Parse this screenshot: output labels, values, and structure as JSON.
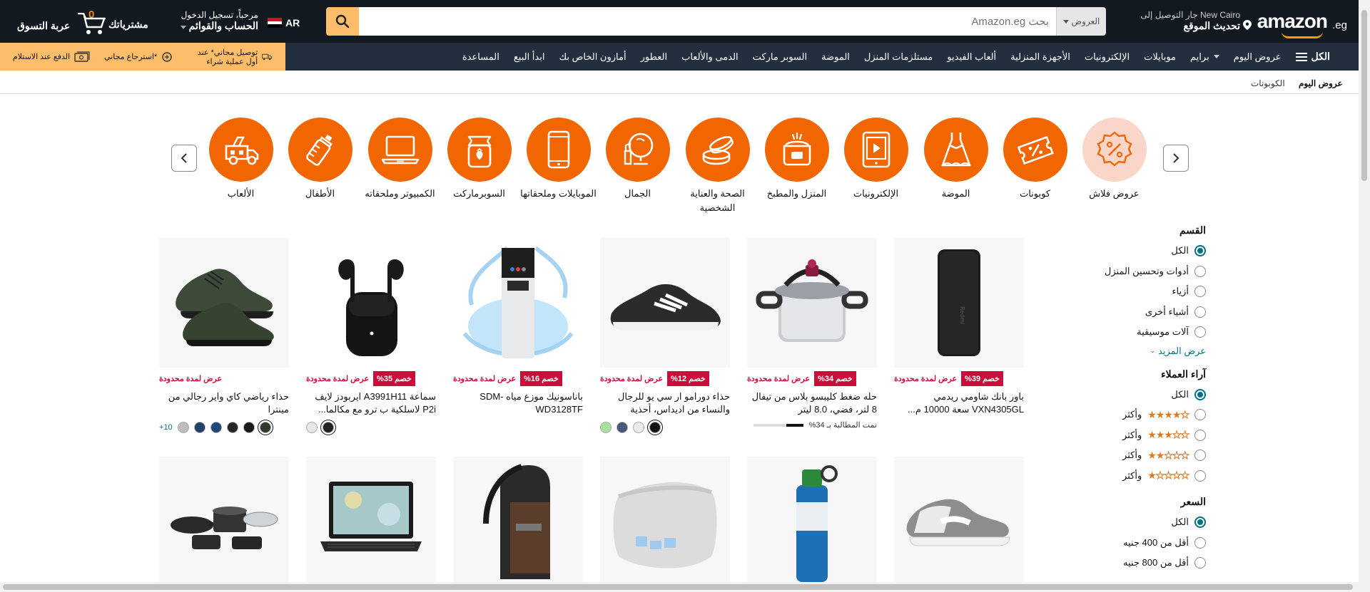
{
  "header": {
    "logo_text": "amazon",
    "logo_tld": ".eg",
    "deliver_line1": "جار التوصيل إلى New Cairo",
    "deliver_line2": "تحديث الموقع",
    "search_dept": "العروض",
    "search_placeholder": "بحث Amazon.eg",
    "lang": "AR",
    "account_line1": "مرحباً، تسجيل الدخول",
    "account_line2": "الحساب والقوائم",
    "orders": "مشترياتك",
    "cart_label": "عربة التسوق",
    "cart_count": "0"
  },
  "nav": {
    "all": "الكل",
    "items": [
      "عروض اليوم",
      "برايم",
      "موبايلات",
      "الإلكترونيات",
      "الأجهزة المنزلية",
      "ألعاب الفيديو",
      "مستلزمات المنزل",
      "الموضة",
      "السوبر ماركت",
      "الدمى والألعاب",
      "العطور",
      "أمازون الخاص بك",
      "ابدأ البيع",
      "المساعدة"
    ],
    "promo": [
      "توصيل مجاني* عند أول عملية شراء",
      "استرجاع مجاني*",
      "الدفع عند الاستلام"
    ]
  },
  "breadcrumb": [
    "عروض اليوم",
    "الكوبونات"
  ],
  "categories": [
    {
      "label": "عروض فلاش",
      "icon": "percent-badge-icon"
    },
    {
      "label": "كوبونات",
      "icon": "coupon-icon"
    },
    {
      "label": "الموضة",
      "icon": "dress-icon"
    },
    {
      "label": "الإلكترونيات",
      "icon": "tablet-play-icon"
    },
    {
      "label": "المنزل والمطبخ",
      "icon": "rice-cooker-icon"
    },
    {
      "label": "الصحة والعناية الشخصية",
      "icon": "cream-jar-icon"
    },
    {
      "label": "الجمال",
      "icon": "mirror-lipstick-icon"
    },
    {
      "label": "الموبايلات وملحقاتها",
      "icon": "phone-icon"
    },
    {
      "label": "السوبرماركت",
      "icon": "jam-jar-icon"
    },
    {
      "label": "الكمبيوتر وملحقاته",
      "icon": "laptop-icon"
    },
    {
      "label": "الأطفال",
      "icon": "baby-bottle-icon"
    },
    {
      "label": "الألعاب",
      "icon": "toy-truck-icon"
    }
  ],
  "sidebar": {
    "dept_title": "القسم",
    "dept_options": [
      "الكل",
      "أدوات وتحسين المنزل",
      "أزياء",
      "أشياء أخرى",
      "آلات موسيقية"
    ],
    "see_more": "عرض المزيد",
    "reviews_title": "آراء العملاء",
    "reviews_all": "الكل",
    "reviews_and_up": "وأكثر",
    "reviews_stars": [
      4,
      3,
      2,
      1
    ],
    "price_title": "السعر",
    "price_options": [
      "الكل",
      "أقل من 400 جنيه",
      "أقل من 800 جنيه"
    ]
  },
  "products": [
    {
      "title": "باور بانك شاومي ريدمي VXN4305GL سعة 10000 م...",
      "discount": "خصم 39%",
      "deal": "عرض لمدة محدودة",
      "image": "power-bank"
    },
    {
      "title": "حله ضغط كليبسو بلاس من تيفال 8 لتر، فضي، 8.0 ليتر",
      "discount": "خصم 34%",
      "deal": "عرض لمدة محدودة",
      "image": "pressure-cooker",
      "claimed": "تمت المطالبة بـ 34%",
      "claimed_pct": 34
    },
    {
      "title": "حذاء دورامو ار سي يو للرجال والنساء من اديداس، أحذية",
      "discount": "خصم 12%",
      "deal": "عرض لمدة محدودة",
      "image": "running-shoe"
    },
    {
      "title": "باناسونيك موزع مياه SDM-WD3128TF",
      "discount": "خصم 16%",
      "deal": "عرض لمدة محدودة",
      "image": "water-dispenser"
    },
    {
      "title": "سماعة A3991H11 ايربودز لايف P2i لاسلكية ب ترو مع مكالما...",
      "discount": "خصم 35%",
      "deal": "عرض لمدة محدودة",
      "image": "earbuds"
    },
    {
      "title": "حذاء رياضي كاي واير رجالي من مينترا",
      "discount": "",
      "deal": "عرض لمدة محدودة",
      "image": "knit-sneaker",
      "more_colors": "10+"
    }
  ],
  "products_row2": [
    "sneaker-gray",
    "water-bottle",
    "pillow",
    "sling-bag",
    "laptop",
    "cookware-set"
  ],
  "colors": {
    "header_bg": "#131921",
    "nav_bg": "#232f3e",
    "accent": "#f16600",
    "search_btn": "#febd69",
    "discount_red": "#cc0c39",
    "link_teal": "#007185"
  }
}
